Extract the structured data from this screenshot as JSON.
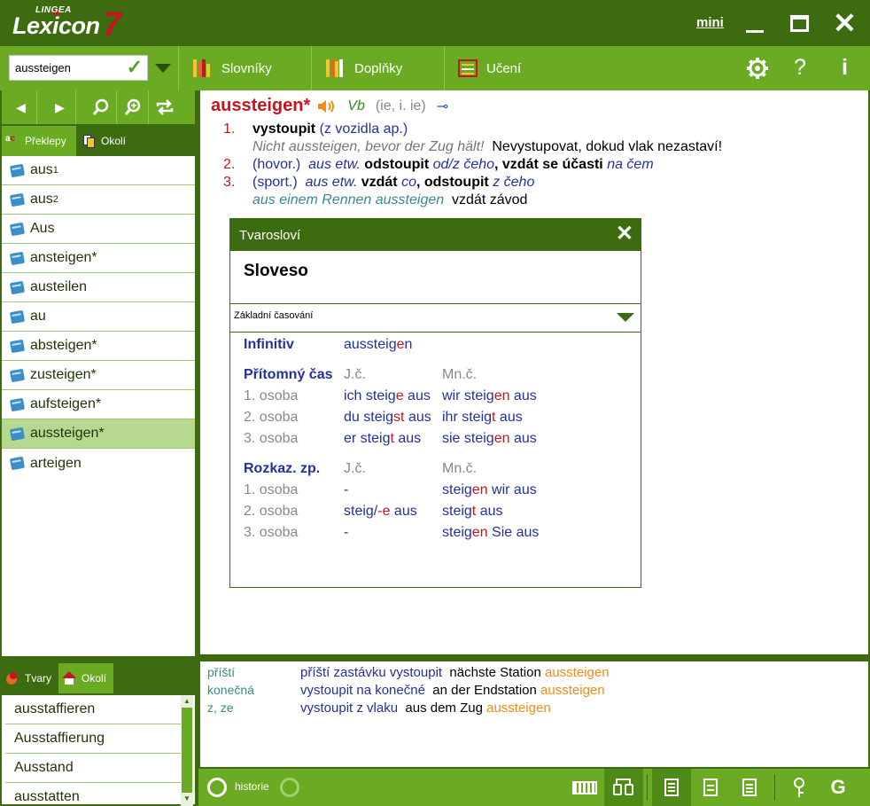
{
  "app": {
    "brand_small": "LINGEA",
    "brand": "Lexicon",
    "version": "7",
    "mini_label": "mini"
  },
  "toolbar": {
    "search_value": "aussteigen",
    "dictionaries": "Slovníky",
    "addons": "Doplňky",
    "learning": "Učení",
    "help": "?",
    "info": "i"
  },
  "left_tabs": {
    "translations": "Překlepy",
    "neighborhood": "Okolí"
  },
  "word_list": [
    {
      "word": "aus",
      "sup": "1"
    },
    {
      "word": "aus",
      "sup": "2"
    },
    {
      "word": "Aus",
      "sup": ""
    },
    {
      "word": "ansteigen*",
      "sup": ""
    },
    {
      "word": "austeilen",
      "sup": ""
    },
    {
      "word": "au",
      "sup": ""
    },
    {
      "word": "absteigen*",
      "sup": ""
    },
    {
      "word": "zusteigen*",
      "sup": ""
    },
    {
      "word": "aufsteigen*",
      "sup": ""
    },
    {
      "word": "aussteigen*",
      "sup": "",
      "selected": true
    },
    {
      "word": "arteigen",
      "sup": ""
    }
  ],
  "bottom_left_tabs": {
    "forms": "Tvary",
    "neighborhood": "Okolí"
  },
  "bottom_left_list": [
    "ausstaffieren",
    "Ausstaffierung",
    "Ausstand",
    "ausstatten"
  ],
  "entry": {
    "headword": "aussteigen*",
    "pos": "Vb",
    "forms": "(ie, i. ie)",
    "senses": {
      "s1": {
        "num": "1.",
        "translation": "vystoupit",
        "note": "(z vozidla ap.)",
        "example_de": "Nicht aussteigen, bevor der Zug hält!",
        "example_cs": "Nevystupovat, dokud vlak nezastaví!"
      },
      "s2": {
        "num": "2.",
        "label": "(hovor.)",
        "de": "aus etw.",
        "t1": "odstoupit",
        "t1_obj": "od/z čeho",
        "t2": "vzdát se účasti",
        "t2_obj": "na čem"
      },
      "s3": {
        "num": "3.",
        "label": "(sport.)",
        "de": "aus etw.",
        "t1": "vzdát",
        "t1_obj": "co",
        "t2": "odstoupit",
        "t2_obj": "z čeho",
        "example_de": "aus einem Rennen aussteigen",
        "example_cs": "vzdát závod"
      }
    }
  },
  "morphology": {
    "title": "Tvarosloví",
    "word_class": "Sloveso",
    "conjugation_select": "Základní časování",
    "infinitive_label": "Infinitiv",
    "infinitive_value": {
      "pre": "aussteig",
      "red": "e",
      "post": "n"
    },
    "present_label": "Přítomný čas",
    "singular": "J.č.",
    "plural": "Mn.č.",
    "person1": "1. osoba",
    "person2": "2. osoba",
    "person3": "3. osoba",
    "present": {
      "p1s": {
        "pre": "ich steig",
        "red": "e",
        "post": " aus"
      },
      "p1p": {
        "pre": "wir steig",
        "red": "en",
        "post": " aus"
      },
      "p2s": {
        "pre": "du steig",
        "red": "st",
        "post": " aus"
      },
      "p2p": {
        "pre": "ihr steig",
        "red": "t",
        "post": " aus"
      },
      "p3s": {
        "pre": "er steig",
        "red": "t",
        "post": " aus"
      },
      "p3p": {
        "pre": "sie steig",
        "red": "en",
        "post": " aus"
      }
    },
    "imperative_label": "Rozkaz. zp.",
    "imperative": {
      "p1s": "-",
      "p1p": {
        "pre": "steig",
        "red": "en",
        "post": " wir aus"
      },
      "p2s": {
        "pre": "steig/",
        "red": "-e",
        "post": " aus"
      },
      "p2p": {
        "pre": "steig",
        "red": "t",
        "post": " aus"
      },
      "p3s": "-",
      "p3p": {
        "pre": "steig",
        "red": "en",
        "post": " Sie aus"
      }
    }
  },
  "examples": [
    {
      "key": "příští",
      "cs": "příští zastávku vystoupit",
      "de_pre": "nächste Station",
      "de_hl": "aussteigen"
    },
    {
      "key": "konečná",
      "cs": "vystoupit na konečné",
      "de_pre": "an der Endstation",
      "de_hl": "aussteigen"
    },
    {
      "key": "z, ze",
      "cs": "vystoupit z vlaku",
      "de_pre": "aus dem Zug",
      "de_hl": "aussteigen"
    }
  ],
  "statusbar": {
    "history": "historie"
  },
  "colors": {
    "dark_green": "#3d6b10",
    "green": "#6aab23",
    "headword_red": "#c8141c",
    "translation_blue": "#23309d",
    "highlight_orange": "#f08c14"
  }
}
